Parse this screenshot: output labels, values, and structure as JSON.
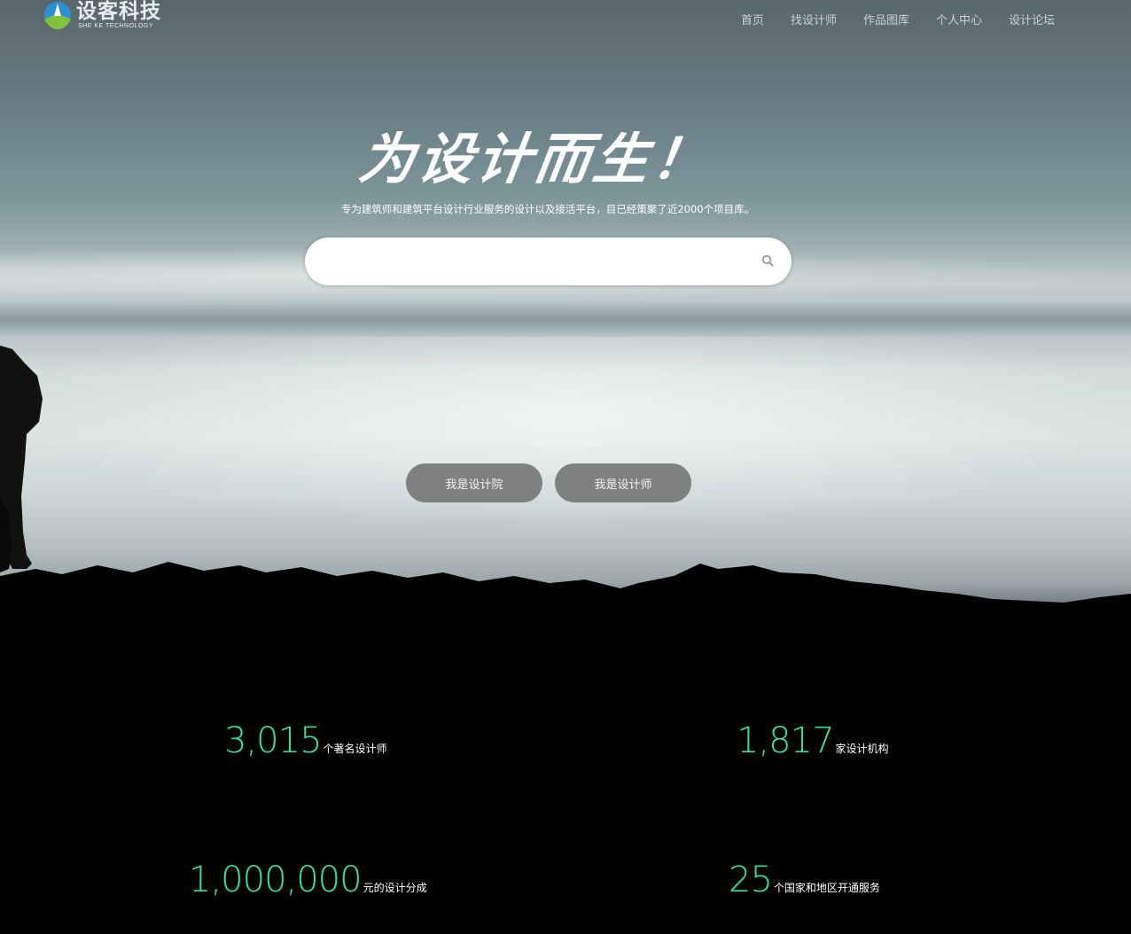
{
  "header": {
    "logo_cn": "设客科技",
    "logo_en": "SHE KE TECHNOLOGY",
    "nav": [
      "首页",
      "找设计师",
      "作品图库",
      "个人中心",
      "设计论坛"
    ]
  },
  "hero": {
    "slogan": "为设计而生！",
    "subtitle": "专为建筑师和建筑平台设计行业服务的设计以及接活平台，目已经策聚了近2000个项目库。",
    "search": {
      "value": "",
      "placeholder": ""
    },
    "buttons": {
      "institute": "我是设计院",
      "designer": "我是设计师"
    }
  },
  "stats": [
    {
      "value": "3,015",
      "label": "个著名设计师"
    },
    {
      "value": "1,817",
      "label": "家设计机构"
    },
    {
      "value": "1,000,000",
      "label": "元的设计分成"
    },
    {
      "value": "25",
      "label": "个国家和地区开通服务"
    }
  ],
  "colors": {
    "accent": "#2fe3a0",
    "button": "#6e6e6e",
    "background": "#000000"
  }
}
